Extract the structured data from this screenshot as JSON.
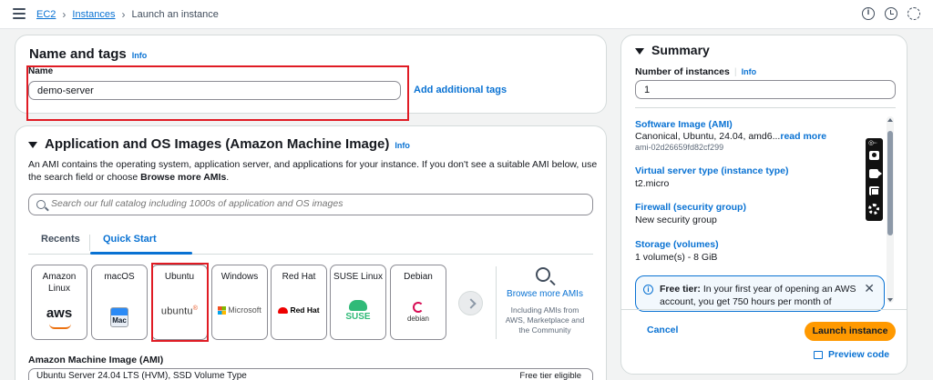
{
  "topbar": {
    "breadcrumbs": [
      "EC2",
      "Instances",
      "Launch an instance"
    ],
    "icons": [
      "info-icon",
      "clock-icon",
      "gear-icon"
    ]
  },
  "name_section": {
    "title": "Name and tags",
    "info": "Info",
    "label": "Name",
    "value": "demo-server",
    "add_tags": "Add additional tags"
  },
  "ami_section": {
    "title": "Application and OS Images (Amazon Machine Image)",
    "info": "Info",
    "description_1": "An AMI contains the operating system, application server, and applications for your instance. If you don't see a suitable AMI below, use the search field or choose ",
    "description_bold": "Browse more AMIs",
    "description_2": ".",
    "search_placeholder": "Search our full catalog including 1000s of application and OS images",
    "tabs": [
      "Recents",
      "Quick Start"
    ],
    "active_tab": "Quick Start",
    "os_options": [
      {
        "name": "Amazon Linux",
        "logo": "aws"
      },
      {
        "name": "macOS",
        "logo": "Mac"
      },
      {
        "name": "Ubuntu",
        "logo": "ubuntu"
      },
      {
        "name": "Windows",
        "logo": "Microsoft"
      },
      {
        "name": "Red Hat",
        "logo": "Red Hat"
      },
      {
        "name": "SUSE Linux",
        "logo": "SUSE"
      },
      {
        "name": "Debian",
        "logo": "debian"
      }
    ],
    "selected_os": "Ubuntu",
    "browse_more": "Browse more AMIs",
    "browse_sub": "Including AMIs from AWS, Marketplace and the Community",
    "ami_label": "Amazon Machine Image (AMI)",
    "ami_value": "Ubuntu Server 24.04 LTS (HVM), SSD Volume Type",
    "ami_badge": "Free tier eligible"
  },
  "summary": {
    "title": "Summary",
    "instances_label": "Number of instances",
    "instances_info": "Info",
    "instances_value": "1",
    "software_image_label": "Software Image (AMI)",
    "software_image_value": "Canonical, Ubuntu, 24.04, amd6...",
    "read_more": "read more",
    "ami_id": "ami-02d26659fd82cf299",
    "instance_type_label": "Virtual server type (instance type)",
    "instance_type_value": "t2.micro",
    "firewall_label": "Firewall (security group)",
    "firewall_value": "New security group",
    "storage_label": "Storage (volumes)",
    "storage_value": "1 volume(s) - 8 GiB",
    "free_tier_bold": "Free tier:",
    "free_tier_text": " In your first year of opening an AWS account, you get 750 hours per month of",
    "cancel": "Cancel",
    "launch": "Launch instance",
    "preview": "Preview code"
  },
  "colors": {
    "accent": "#0972d3",
    "launch_button": "#ff9900",
    "highlight_box": "#e01b24"
  }
}
